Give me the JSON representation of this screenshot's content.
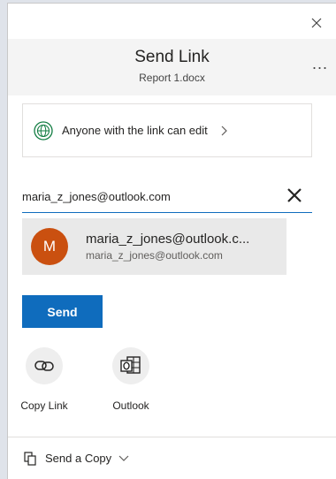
{
  "dialog": {
    "title": "Send Link",
    "subtitle": "Report 1.docx",
    "more_label": "..."
  },
  "permission": {
    "text": "Anyone with the link can edit",
    "icon": "globe-icon"
  },
  "recipient": {
    "value": "maria_z_jones@outlook.com",
    "placeholder": ""
  },
  "suggestion": {
    "initial": "M",
    "name": "maria_z_jones@outlook.c...",
    "email": "maria_z_jones@outlook.com",
    "avatar_color": "#ca5010"
  },
  "send": {
    "label": "Send",
    "color": "#0f6cbd"
  },
  "share_options": [
    {
      "label": "Copy Link",
      "icon": "link-icon"
    },
    {
      "label": "Outlook",
      "icon": "outlook-icon"
    }
  ],
  "footer": {
    "label": "Send a Copy",
    "icon": "copy-icon"
  }
}
